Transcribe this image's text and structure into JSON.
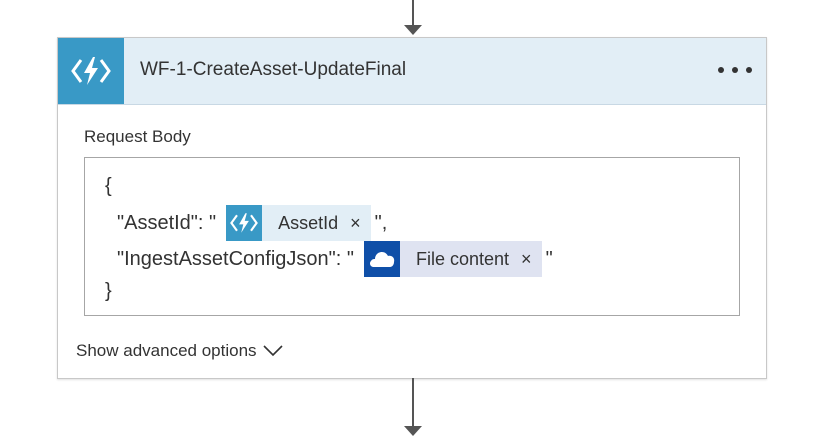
{
  "action": {
    "title": "WF-1-CreateAsset-UpdateFinal",
    "icon": "azure-function-icon",
    "more_icon": "more-options-icon",
    "accent_color": "#3999c6"
  },
  "request_body": {
    "label": "Request Body",
    "open_brace": "{",
    "close_brace": "}",
    "line1_key": "\"AssetId\": \"",
    "line1_suffix": "\",",
    "line2_key": "\"IngestAssetConfigJson\": \"",
    "line2_suffix": "\"",
    "tokens": [
      {
        "label": "AssetId",
        "icon": "azure-function-icon",
        "close": "×"
      },
      {
        "label": "File content",
        "icon": "onedrive-icon",
        "close": "×"
      }
    ]
  },
  "advanced_options": {
    "label": "Show advanced options",
    "icon": "chevron-down-icon"
  }
}
